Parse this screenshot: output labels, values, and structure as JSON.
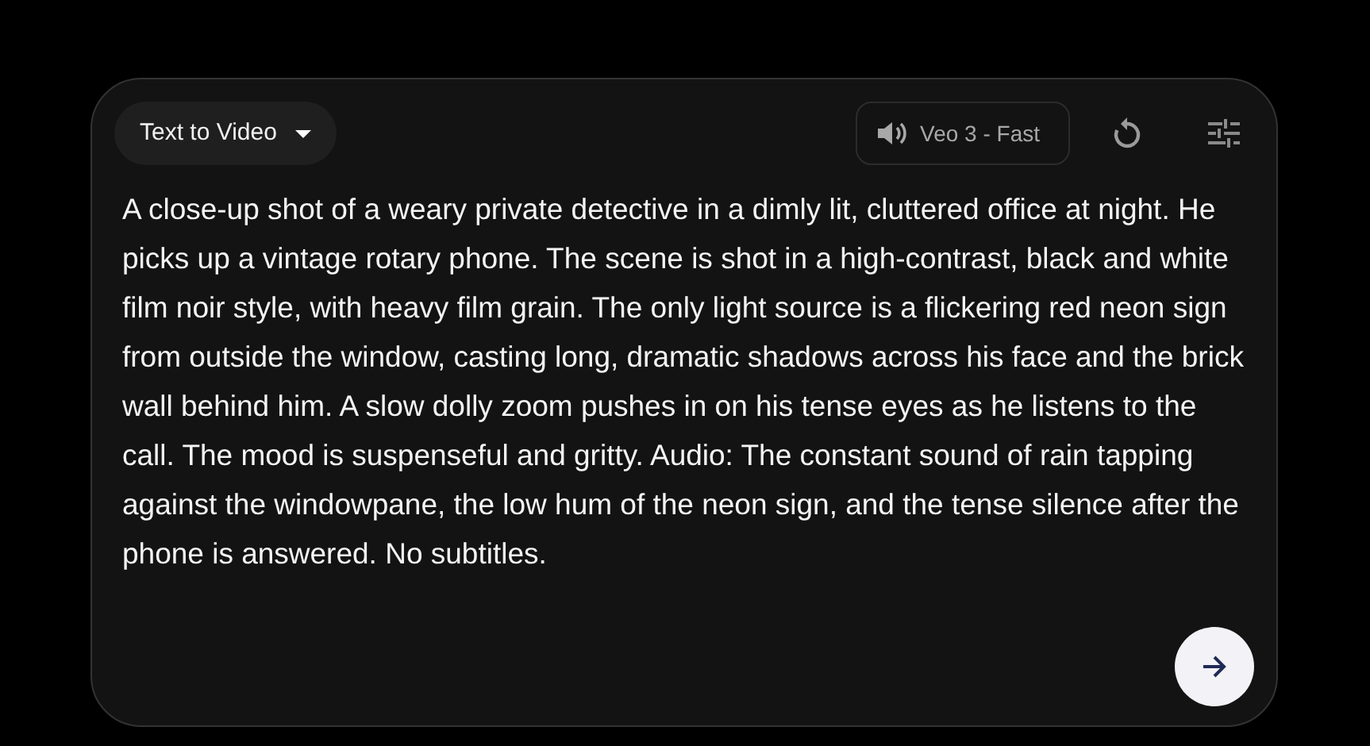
{
  "mode_dropdown": {
    "label": "Text to Video"
  },
  "model_button": {
    "label": "Veo 3 - Fast"
  },
  "prompt": {
    "value": "A close-up shot of a weary private detective in a dimly lit, cluttered office at night. He picks up a vintage rotary phone. The scene is shot in a high-contrast, black and white film noir style, with heavy film grain. The only light source is a flickering red neon sign from outside the window, casting long, dramatic shadows across his face and the brick wall behind him. A slow dolly zoom pushes in on his tense eyes as he listens to the call. The mood is suspenseful and gritty. Audio: The constant sound of rain tapping against the windowpane, the low hum of the neon sign, and the tense silence after the phone is answered. No subtitles."
  }
}
